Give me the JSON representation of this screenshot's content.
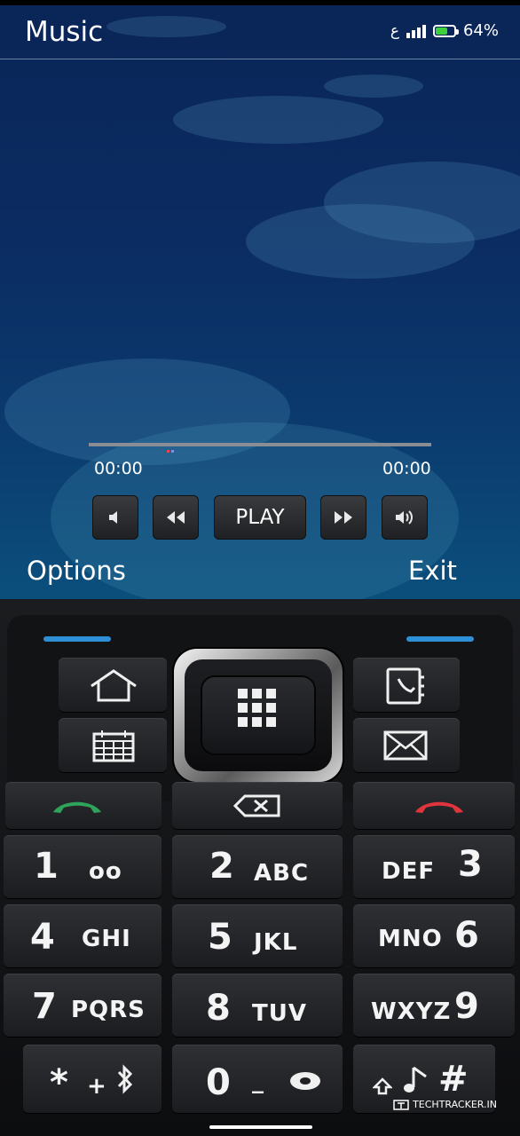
{
  "header": {
    "title": "Music",
    "status_icon_label": "ع",
    "battery": "64%",
    "battery_level": 0.64
  },
  "player": {
    "elapsed": "00:00",
    "total": "00:00",
    "progress": 0.0,
    "controls": {
      "vol_down_icon": "volume-low-icon",
      "rewind_icon": "rewind-icon",
      "play_label": "PLAY",
      "forward_icon": "fast-forward-icon",
      "vol_up_icon": "volume-high-icon"
    }
  },
  "softkeys": {
    "left": "Options",
    "right": "Exit"
  },
  "keypad": {
    "keys": [
      {
        "num": "1",
        "letters": "oo"
      },
      {
        "num": "2",
        "letters": "ABC"
      },
      {
        "num": "3",
        "letters": "DEF"
      },
      {
        "num": "4",
        "letters": "GHI"
      },
      {
        "num": "5",
        "letters": "JKL"
      },
      {
        "num": "6",
        "letters": "MNO"
      },
      {
        "num": "7",
        "letters": "PQRS"
      },
      {
        "num": "8",
        "letters": "TUV"
      },
      {
        "num": "9",
        "letters": "WXYZ"
      },
      {
        "num": "*",
        "letters": "+"
      },
      {
        "num": "0",
        "letters": "_"
      },
      {
        "num": "#",
        "letters": ""
      }
    ]
  },
  "watermark": "TECHTRACKER.IN",
  "colors": {
    "accent_blue": "#2d8fd6",
    "call_green": "#2fa35a",
    "end_red": "#e2343d",
    "battery": "#3ed13a"
  }
}
